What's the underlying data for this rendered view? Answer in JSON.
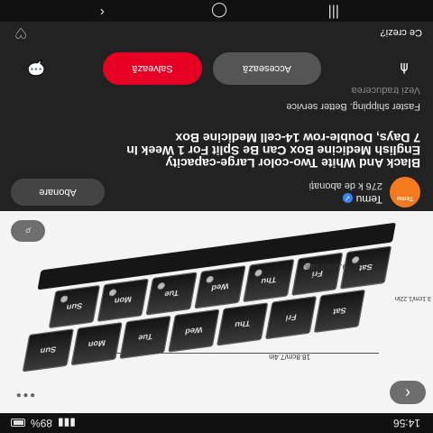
{
  "status_bar": {
    "time": "14:56",
    "battery": "89%"
  },
  "product_image": {
    "back_glyph": "‹",
    "more_glyph": "•••",
    "lens_glyph": "⌕",
    "dims": {
      "length": "18.8cm/7.4in",
      "height": "3.1cm/1.22in",
      "width": "9.1cm/3.58in"
    },
    "compartments_top": [
      "Sat",
      "Fri",
      "Thu",
      "Wed",
      "Tue",
      "Mon",
      "Sun"
    ],
    "compartments_bottom": [
      "Sat",
      "Fri",
      "Thu",
      "Wed",
      "Tue",
      "Mon",
      "Sun"
    ]
  },
  "seller": {
    "logo_text": "Temu",
    "name": "Temu",
    "followers": "276 k de abonați",
    "subscribe_label": "Abonare"
  },
  "title": "Black And White Two-color Large-capacity English Medicine Box Can Be Split For 1 Week In 7 Days, Double-row 14-cell Medicine Box",
  "shipping_text": "Faster shipping. Better service",
  "translate_text": "Vezi traducerea",
  "actions": {
    "access_label": "Accesează",
    "save_label": "Salvează"
  },
  "comment_prompt": "Ce crezi?",
  "colors": {
    "accent": "#e60023",
    "brand": "#f47a1f"
  }
}
